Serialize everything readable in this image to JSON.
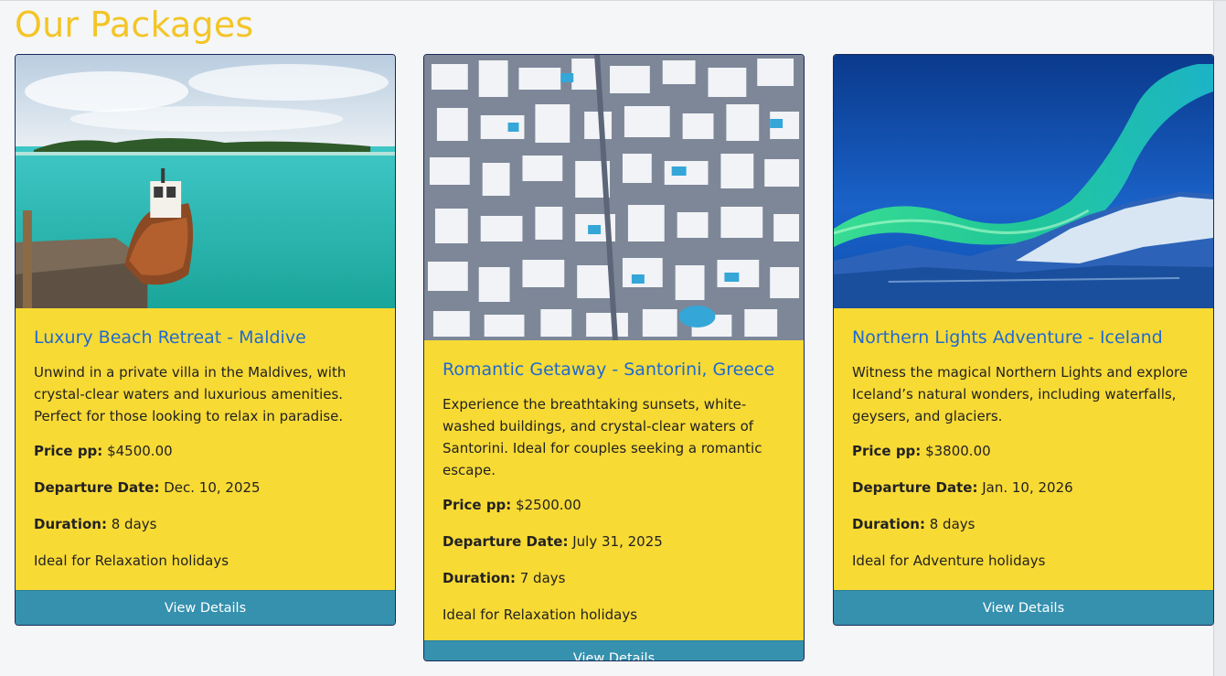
{
  "page": {
    "title": "Our Packages"
  },
  "colors": {
    "title": "#f3c526",
    "card_bg": "#f8da35",
    "link": "#1f6ad0",
    "button": "#3591ae"
  },
  "packages": [
    {
      "title": "Luxury Beach Retreat - Maldive",
      "image_desc": "tropical lagoon with wooden boat icon",
      "description": "Unwind in a private villa in the Maldives, with crystal-clear waters and luxurious amenities. Perfect for those looking to relax in paradise.",
      "price_label": "Price pp:",
      "price": "$4500.00",
      "departure_label": "Departure Date:",
      "departure": "Dec. 10, 2025",
      "duration_label": "Duration:",
      "duration": "8 days",
      "ideal": "Ideal for Relaxation holidays",
      "button": "View Details"
    },
    {
      "title": "Romantic Getaway - Santorini, Greece",
      "image_desc": "aerial white-washed town icon",
      "description": "Experience the breathtaking sunsets, white-washed buildings, and crystal-clear waters of Santorini. Ideal for couples seeking a romantic escape.",
      "price_label": "Price pp:",
      "price": "$2500.00",
      "departure_label": "Departure Date:",
      "departure": "July 31, 2025",
      "duration_label": "Duration:",
      "duration": "7 days",
      "ideal": "Ideal for Relaxation holidays",
      "button": "View Details"
    },
    {
      "title": "Northern Lights Adventure - Iceland",
      "image_desc": "aurora over snowy mountains icon",
      "description": "Witness the magical Northern Lights and explore Iceland’s natural wonders, including waterfalls, geysers, and glaciers.",
      "price_label": "Price pp:",
      "price": "$3800.00",
      "departure_label": "Departure Date:",
      "departure": "Jan. 10, 2026",
      "duration_label": "Duration:",
      "duration": "8 days",
      "ideal": "Ideal for Adventure holidays",
      "button": "View Details"
    }
  ]
}
